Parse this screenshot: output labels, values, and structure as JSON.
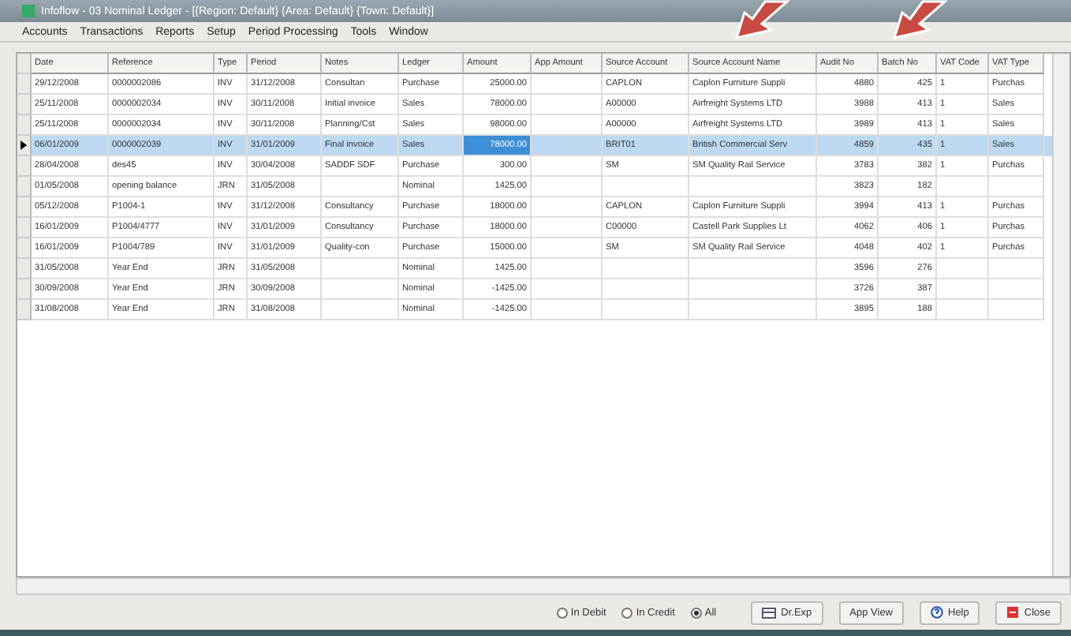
{
  "window": {
    "title": "Infoflow - 03 Nominal Ledger - [{Region: Default} {Area: Default} {Town: Default}]"
  },
  "menu": [
    "Accounts",
    "Transactions",
    "Reports",
    "Setup",
    "Period Processing",
    "Tools",
    "Window"
  ],
  "table": {
    "columns": [
      "Date",
      "Reference",
      "Type",
      "Period",
      "Notes",
      "Ledger",
      "Amount",
      "App Amount",
      "Source Account",
      "Source Account Name",
      "Audit No",
      "Batch No",
      "VAT Code",
      "VAT Type"
    ],
    "rows": [
      {
        "selected": false,
        "cells": [
          "29/12/2008",
          "0000002086",
          "INV",
          "31/12/2008",
          "Consultan",
          "Purchase",
          "25000.00",
          "",
          "CAPLON",
          "Caplon Furniture Suppli",
          "4880",
          "425",
          "1",
          "Purchas"
        ]
      },
      {
        "selected": false,
        "cells": [
          "25/11/2008",
          "0000002034",
          "INV",
          "30/11/2008",
          "Initial invoice",
          "Sales",
          "78000.00",
          "",
          "A00000",
          "Airfreight Systems LTD",
          "3988",
          "413",
          "1",
          "Sales"
        ]
      },
      {
        "selected": false,
        "cells": [
          "25/11/2008",
          "0000002034",
          "INV",
          "30/11/2008",
          "Planning/Cst",
          "Sales",
          "98000.00",
          "",
          "A00000",
          "Airfreight Systems LTD",
          "3989",
          "413",
          "1",
          "Sales"
        ]
      },
      {
        "selected": true,
        "cells": [
          "06/01/2009",
          "0000002039",
          "INV",
          "31/01/2009",
          "Final invoice",
          "Sales",
          "78000.00",
          "",
          "BRIT01",
          "British Commercial Serv",
          "4859",
          "435",
          "1",
          "Sales"
        ]
      },
      {
        "selected": false,
        "cells": [
          "28/04/2008",
          "des45",
          "INV",
          "30/04/2008",
          "SADDF SDF",
          "Purchase",
          "300.00",
          "",
          "SM",
          "SM Quality Rail Service",
          "3783",
          "382",
          "1",
          "Purchas"
        ]
      },
      {
        "selected": false,
        "cells": [
          "01/05/2008",
          "opening balance",
          "JRN",
          "31/05/2008",
          "",
          "Nominal",
          "1425.00",
          "",
          "",
          "",
          "3823",
          "182",
          "",
          ""
        ]
      },
      {
        "selected": false,
        "cells": [
          "05/12/2008",
          "P1004-1",
          "INV",
          "31/12/2008",
          "Consultancy",
          "Purchase",
          "18000.00",
          "",
          "CAPLON",
          "Caplon Furniture Suppli",
          "3994",
          "413",
          "1",
          "Purchas"
        ]
      },
      {
        "selected": false,
        "cells": [
          "16/01/2009",
          "P1004/4777",
          "INV",
          "31/01/2009",
          "Consultancy",
          "Purchase",
          "18000.00",
          "",
          "C00000",
          "Castell Park Supplies Lt",
          "4062",
          "406",
          "1",
          "Purchas"
        ]
      },
      {
        "selected": false,
        "cells": [
          "16/01/2009",
          "P1004/789",
          "INV",
          "31/01/2009",
          "Quality-con",
          "Purchase",
          "15000.00",
          "",
          "SM",
          "SM Quality Rail Service",
          "4048",
          "402",
          "1",
          "Purchas"
        ]
      },
      {
        "selected": false,
        "cells": [
          "31/05/2008",
          "Year End",
          "JRN",
          "31/05/2008",
          "",
          "Nominal",
          "1425.00",
          "",
          "",
          "",
          "3596",
          "276",
          "",
          ""
        ]
      },
      {
        "selected": false,
        "cells": [
          "30/09/2008",
          "Year End",
          "JRN",
          "30/09/2008",
          "",
          "Nominal",
          "-1425.00",
          "",
          "",
          "",
          "3726",
          "387",
          "",
          ""
        ]
      },
      {
        "selected": false,
        "cells": [
          "31/08/2008",
          "Year End",
          "JRN",
          "31/08/2008",
          "",
          "Nominal",
          "-1425.00",
          "",
          "",
          "",
          "3895",
          "188",
          "",
          ""
        ]
      }
    ]
  },
  "filters": [
    {
      "label": "In Debit",
      "selected": false
    },
    {
      "label": "In Credit",
      "selected": false
    },
    {
      "label": "All",
      "selected": true
    }
  ],
  "buttons": [
    {
      "kind": "export",
      "label": "Dr.Exp"
    },
    {
      "kind": "plain",
      "label": "App View"
    },
    {
      "kind": "help",
      "label": "Help"
    },
    {
      "kind": "close",
      "label": "Close"
    }
  ]
}
